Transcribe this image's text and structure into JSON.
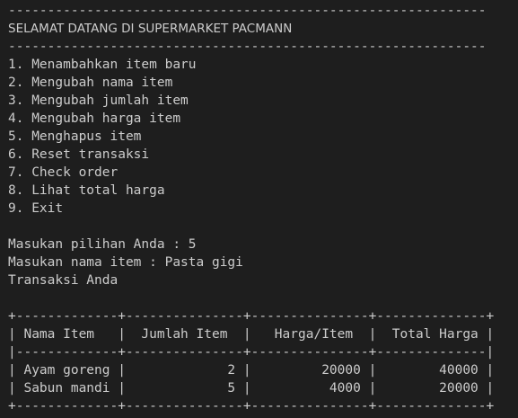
{
  "header": {
    "rule": "-------------------------------------------------------------",
    "title": "SELAMAT DATANG DI SUPERMARKET PACMANN"
  },
  "menu": {
    "items": [
      "1. Menambahkan item baru",
      "2. Mengubah nama item",
      "3. Mengubah jumlah item",
      "4. Mengubah harga item",
      "5. Menghapus item",
      "6. Reset transaksi",
      "7. Check order",
      "8. Lihat total harga",
      "9. Exit"
    ]
  },
  "session": {
    "choice_prompt": "Masukan pilihan Anda : 5",
    "item_prompt": "Masukan nama item : Pasta gigi",
    "transaction_label": "Transaksi Anda"
  },
  "table": {
    "border": "+-------------+---------------+---------------+--------------+",
    "header_row": "| Nama Item   |  Jumlah Item  |   Harga/Item  |  Total Harga |",
    "separator": "|-------------+---------------+---------------+--------------|",
    "rows": [
      "| Ayam goreng |             2 |         20000 |        40000 |",
      "| Sabun mandi |             5 |          4000 |        20000 |"
    ]
  }
}
